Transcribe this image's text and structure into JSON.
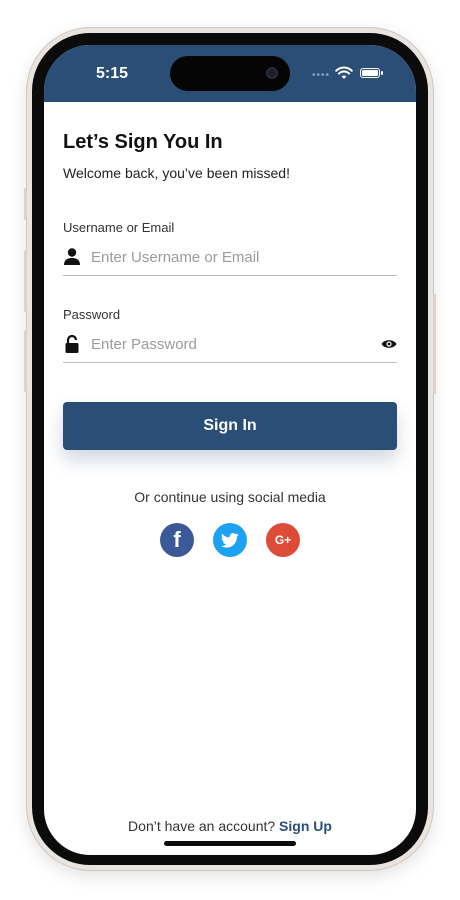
{
  "status_bar": {
    "time": "5:15",
    "background": "#2a4e76"
  },
  "header": {
    "title": "Let’s Sign You In",
    "subtitle": "Welcome back, you’ve been missed!"
  },
  "username_field": {
    "label": "Username or Email",
    "placeholder": "Enter Username or Email",
    "value": "",
    "icon": "user-icon"
  },
  "password_field": {
    "label": "Password",
    "placeholder": "Enter Password",
    "value": "",
    "icon": "lock-icon",
    "toggle_icon": "eye-icon"
  },
  "signin_button": {
    "label": "Sign In",
    "color": "#2a4e76"
  },
  "social": {
    "prompt": "Or continue using social media",
    "buttons": [
      {
        "name": "facebook",
        "glyph": "f",
        "color": "#3b5998"
      },
      {
        "name": "twitter",
        "glyph": "twitter-bird-icon",
        "color": "#1da1f2"
      },
      {
        "name": "google-plus",
        "glyph": "G+",
        "color": "#dd4b39"
      }
    ]
  },
  "footer": {
    "prompt": "Don’t have an account?",
    "link": "Sign Up"
  }
}
